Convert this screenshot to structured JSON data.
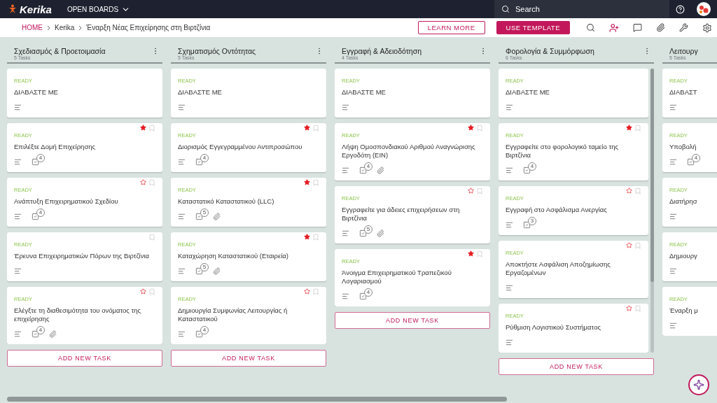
{
  "app": {
    "logo": "Kerika",
    "menu": "OPEN BOARDS",
    "search_placeholder": "Search"
  },
  "breadcrumb": [
    "HOME",
    "Kerika",
    "Έναρξη Νέας Επιχείρησης στη Βιρτζίνια"
  ],
  "actions": [
    {
      "label": "LEARN MORE",
      "kind": "outline"
    },
    {
      "label": "USE TEMPLATE",
      "kind": "filled"
    }
  ],
  "columns": [
    {
      "title": "Σχεδιασμός & Προετοιμασία",
      "count": "5 Tasks",
      "scrollbar": false,
      "add_label": "ADD NEW TASK",
      "tasks": [
        {
          "status": "READY",
          "title": "ΔΙΑΒΑΣΤΕ ΜΕ",
          "star": false,
          "bookmark": false,
          "attachment": false
        },
        {
          "status": "READY",
          "title": "Επιλέξτε Δομή Επιχείρησης",
          "star": true,
          "starred": true,
          "bookmark": true,
          "checklist": "4",
          "attachment": false
        },
        {
          "status": "READY",
          "title": "Ανάπτυξη Επιχειρηματικού Σχεδίου",
          "star": true,
          "starred": false,
          "bookmark": true,
          "checklist": "4",
          "attachment": false
        },
        {
          "status": "READY",
          "title": "Έρευνα Επιχειρηματικών Πόρων της Βιρτζίνια",
          "star": false,
          "bookmark": true,
          "attachment": false
        },
        {
          "status": "READY",
          "title": "Ελέγξτε τη διαθεσιμότητα του ονόματος της επιχείρησης",
          "star": true,
          "starred": false,
          "bookmark": true,
          "checklist": "4",
          "attachment": true
        }
      ]
    },
    {
      "title": "Σχηματισμός Οντότητας",
      "count": "5 Tasks",
      "scrollbar": false,
      "add_label": "ADD NEW TASK",
      "tasks": [
        {
          "status": "READY",
          "title": "ΔΙΑΒΑΣΤΕ ΜΕ",
          "star": false,
          "bookmark": false,
          "attachment": false
        },
        {
          "status": "READY",
          "title": "Διορισμός Εγγεγραμμένου Αντιπροσώπου",
          "star": true,
          "starred": true,
          "bookmark": true,
          "checklist": "4",
          "attachment": false
        },
        {
          "status": "READY",
          "title": "Καταστατικό Καταστατικού (LLC)",
          "star": true,
          "starred": true,
          "bookmark": true,
          "checklist": "5",
          "attachment": true
        },
        {
          "status": "READY",
          "title": "Καταχώρηση Καταστατικού (Εταιρεία)",
          "star": true,
          "starred": true,
          "bookmark": true,
          "checklist": "5",
          "attachment": true
        },
        {
          "status": "READY",
          "title": "Δημιουργία Συμφωνίας Λειτουργίας ή Καταστατικού",
          "star": true,
          "starred": false,
          "bookmark": true,
          "checklist": "4",
          "attachment": false
        }
      ]
    },
    {
      "title": "Εγγραφή & Αδειοδότηση",
      "count": "4 Tasks",
      "scrollbar": false,
      "add_label": "ADD NEW TASK",
      "tasks": [
        {
          "status": "READY",
          "title": "ΔΙΑΒΑΣΤΕ ΜΕ",
          "star": false,
          "bookmark": false,
          "attachment": false
        },
        {
          "status": "READY",
          "title": "Λήψη Ομοσπονδιακού Αριθμού Αναγνώρισης Εργοδότη (EIN)",
          "star": true,
          "starred": true,
          "bookmark": true,
          "checklist": "4",
          "attachment": true
        },
        {
          "status": "READY",
          "title": "Εγγραφείτε για άδειες επιχειρήσεων στη Βιρτζίνια",
          "star": true,
          "starred": false,
          "bookmark": true,
          "checklist": "5",
          "attachment": true
        },
        {
          "status": "READY",
          "title": "Άνοιγμα Επιχειρηματικού Τραπεζικού Λογαριασμού",
          "star": true,
          "starred": true,
          "bookmark": true,
          "checklist": "4",
          "attachment": false
        }
      ]
    },
    {
      "title": "Φορολογία & Συμμόρφωση",
      "count": "6 Tasks",
      "scrollbar": true,
      "add_label": "ADD NEW TASK",
      "tasks": [
        {
          "status": "READY",
          "title": "ΔΙΑΒΑΣΤΕ ΜΕ",
          "star": false,
          "bookmark": false,
          "attachment": false
        },
        {
          "status": "READY",
          "title": "Εγγραφείτε στο φορολογικό ταμείο της Βιρτζίνια",
          "star": true,
          "starred": true,
          "bookmark": true,
          "checklist": "4",
          "attachment": false
        },
        {
          "status": "READY",
          "title": "Εγγραφή στο Ασφάλισμα Ανεργίας",
          "star": true,
          "starred": false,
          "bookmark": true,
          "checklist": "3",
          "attachment": false
        },
        {
          "status": "READY",
          "title": "Αποκτήστε Ασφάλιση Αποζημίωσης Εργαζομένων",
          "star": true,
          "starred": false,
          "bookmark": true,
          "attachment": false
        },
        {
          "status": "READY",
          "title": "Ρύθμιση Λογιστικού Συστήματος",
          "star": true,
          "starred": false,
          "bookmark": true,
          "attachment": false
        }
      ]
    },
    {
      "title": "Λειτουργ",
      "count": "5 Tasks",
      "scrollbar": false,
      "tasks": [
        {
          "status": "READY",
          "title": "ΔΙΑΒΑΣΤ",
          "star": false,
          "bookmark": false,
          "attachment": false
        },
        {
          "status": "READY",
          "title": "Υποβολή",
          "star": false,
          "bookmark": false,
          "checklist": "4",
          "attachment": false
        },
        {
          "status": "READY",
          "title": "Διατήρησ",
          "star": false,
          "bookmark": false,
          "attachment": false
        },
        {
          "status": "READY",
          "title": "Δημιουργ",
          "star": false,
          "bookmark": false,
          "attachment": false
        },
        {
          "status": "READY",
          "title": "Έναρξη μ",
          "star": false,
          "bookmark": false,
          "attachment": false
        }
      ]
    }
  ]
}
